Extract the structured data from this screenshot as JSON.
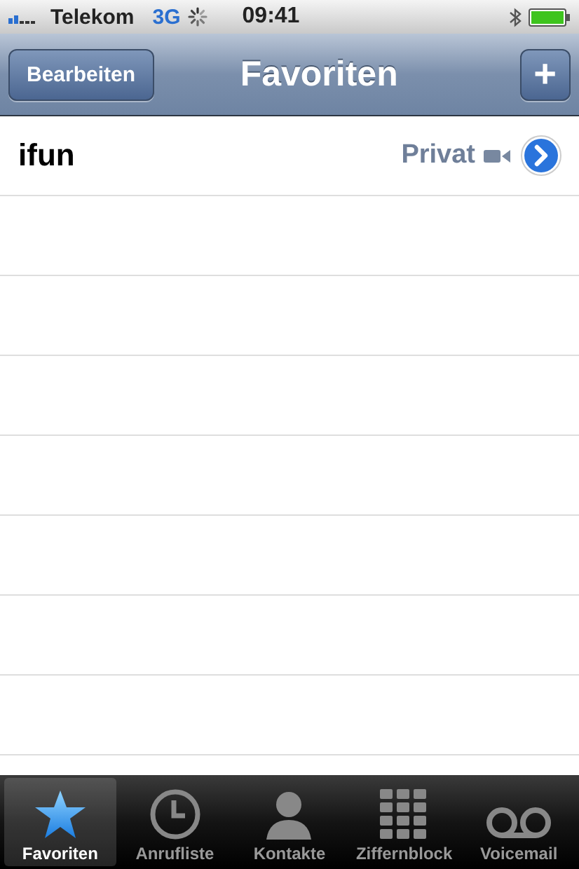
{
  "status_bar": {
    "carrier": "Telekom",
    "network": "3G",
    "time": "09:41"
  },
  "nav_bar": {
    "left_button": "Bearbeiten",
    "title": "Favoriten",
    "right_button": "+"
  },
  "favorites": [
    {
      "name": "ifun",
      "label": "Privat",
      "video": true
    }
  ],
  "tab_bar": [
    {
      "label": "Favoriten",
      "selected": true
    },
    {
      "label": "Anrufliste",
      "selected": false
    },
    {
      "label": "Kontakte",
      "selected": false
    },
    {
      "label": "Ziffernblock",
      "selected": false
    },
    {
      "label": "Voicemail",
      "selected": false
    }
  ]
}
